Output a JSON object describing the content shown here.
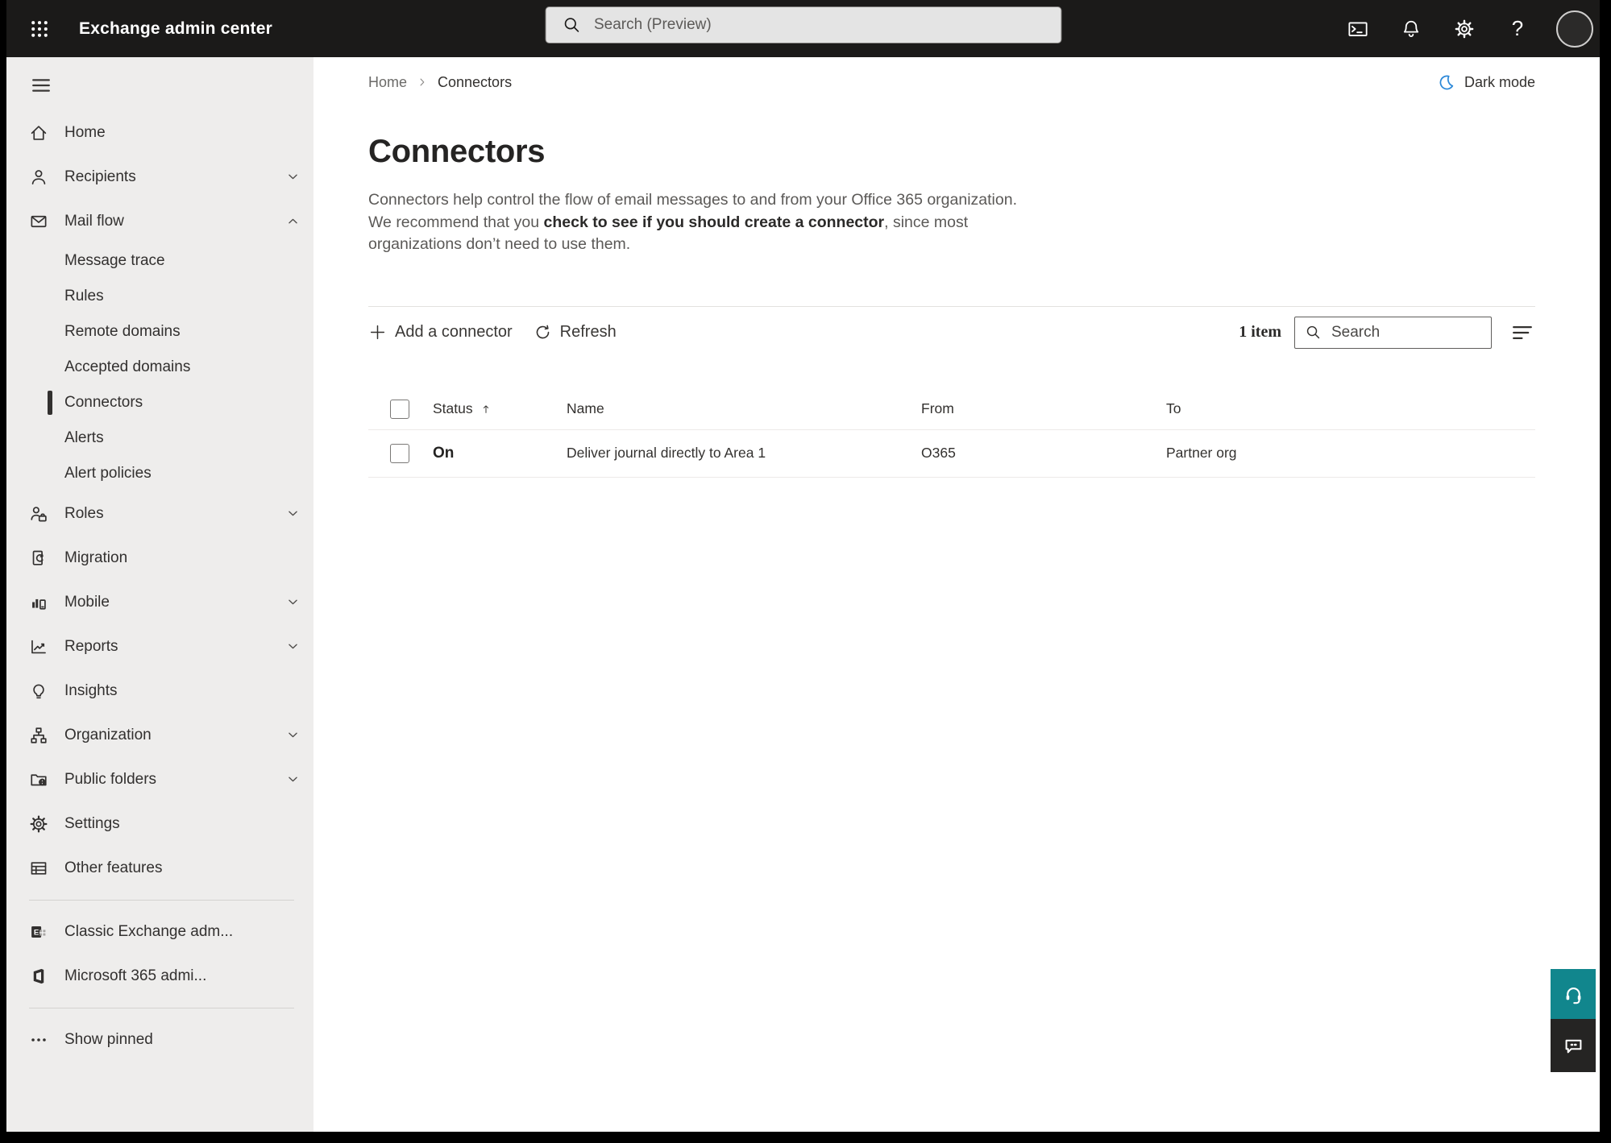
{
  "topbar": {
    "title": "Exchange admin center",
    "search_placeholder": "Search (Preview)"
  },
  "sidebar": {
    "items": [
      {
        "type": "item",
        "icon": "home",
        "label": "Home"
      },
      {
        "type": "item",
        "icon": "person",
        "label": "Recipients",
        "chevron": "down"
      },
      {
        "type": "item",
        "icon": "mail",
        "label": "Mail flow",
        "chevron": "up"
      },
      {
        "type": "sub",
        "label": "Message trace"
      },
      {
        "type": "sub",
        "label": "Rules"
      },
      {
        "type": "sub",
        "label": "Remote domains"
      },
      {
        "type": "sub",
        "label": "Accepted domains"
      },
      {
        "type": "sub",
        "label": "Connectors",
        "selected": true
      },
      {
        "type": "sub",
        "label": "Alerts"
      },
      {
        "type": "sub",
        "label": "Alert policies"
      },
      {
        "type": "item",
        "icon": "roles",
        "label": "Roles",
        "chevron": "down"
      },
      {
        "type": "item",
        "icon": "migration",
        "label": "Migration"
      },
      {
        "type": "item",
        "icon": "mobile",
        "label": "Mobile",
        "chevron": "down"
      },
      {
        "type": "item",
        "icon": "reports",
        "label": "Reports",
        "chevron": "down"
      },
      {
        "type": "item",
        "icon": "insights",
        "label": "Insights"
      },
      {
        "type": "item",
        "icon": "organization",
        "label": "Organization",
        "chevron": "down"
      },
      {
        "type": "item",
        "icon": "public-folders",
        "label": "Public folders",
        "chevron": "down"
      },
      {
        "type": "item",
        "icon": "settings",
        "label": "Settings"
      },
      {
        "type": "item",
        "icon": "other-features",
        "label": "Other features"
      },
      {
        "type": "divider"
      },
      {
        "type": "item",
        "icon": "classic-exchange",
        "label": "Classic Exchange adm..."
      },
      {
        "type": "item",
        "icon": "m365",
        "label": "Microsoft 365 admi..."
      },
      {
        "type": "divider"
      },
      {
        "type": "item",
        "icon": "ellipsis",
        "label": "Show pinned"
      }
    ]
  },
  "breadcrumb": {
    "home": "Home",
    "current": "Connectors"
  },
  "dark_mode": {
    "label": "Dark mode",
    "icon_color": "#2b88d8"
  },
  "page": {
    "title": "Connectors",
    "description_pre": "Connectors help control the flow of email messages to and from your Office 365 organization. We recommend that you ",
    "description_link": "check to see if you should create a connector",
    "description_post": ", since most organizations don’t need to use them."
  },
  "toolbar": {
    "add_label": "Add a connector",
    "refresh_label": "Refresh",
    "item_count": "1 item",
    "search_placeholder": "Search"
  },
  "table": {
    "headers": [
      {
        "label": "Status",
        "sort": "asc"
      },
      {
        "label": "Name"
      },
      {
        "label": "From"
      },
      {
        "label": "To"
      }
    ],
    "rows": [
      {
        "status": "On",
        "name": "Deliver journal directly to Area 1",
        "from": "O365",
        "to": "Partner org"
      }
    ]
  },
  "colors": {
    "topbar_bg": "#1b1a19",
    "sidebar_bg": "#eeedec",
    "selected_indicator": "#32302f",
    "help_button_bg": "#11868d",
    "feedback_button_bg": "#252423"
  }
}
